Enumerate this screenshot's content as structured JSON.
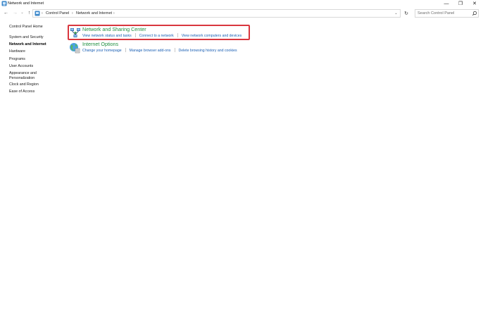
{
  "window": {
    "title": "Network and Internet",
    "minimize_glyph": "—",
    "maximize_glyph": "❐",
    "close_glyph": "✕"
  },
  "nav": {
    "back_glyph": "←",
    "forward_glyph": "→",
    "recent_glyph": "⌄",
    "up_glyph": "↑",
    "refresh_glyph": "↻"
  },
  "address": {
    "separator": "›",
    "breadcrumbs": [
      "Control Panel",
      "Network and Internet"
    ],
    "dropdown_glyph": "⌄"
  },
  "search": {
    "placeholder": "Search Control Panel"
  },
  "sidebar": {
    "items": [
      {
        "label": "Control Panel Home"
      },
      {
        "label": "System and Security"
      },
      {
        "label": "Network and Internet",
        "current": true
      },
      {
        "label": "Hardware"
      },
      {
        "label": "Programs"
      },
      {
        "label": "User Accounts"
      },
      {
        "label": "Appearance and"
      },
      {
        "label": "Personalization"
      },
      {
        "label": "Clock and Region"
      },
      {
        "label": "Ease of Access"
      }
    ]
  },
  "categories": [
    {
      "title": "Network and Sharing Center",
      "icon": "network-sharing-icon",
      "links": [
        "View network status and tasks",
        "Connect to a network",
        "View network computers and devices"
      ]
    },
    {
      "title": "Internet Options",
      "icon": "internet-options-icon",
      "links": [
        "Change your homepage",
        "Manage browser add-ons",
        "Delete browsing history and cookies"
      ]
    }
  ],
  "colors": {
    "category_title": "#1e8e3e",
    "link": "#1a5fb4",
    "highlight_border": "#d9363e"
  }
}
